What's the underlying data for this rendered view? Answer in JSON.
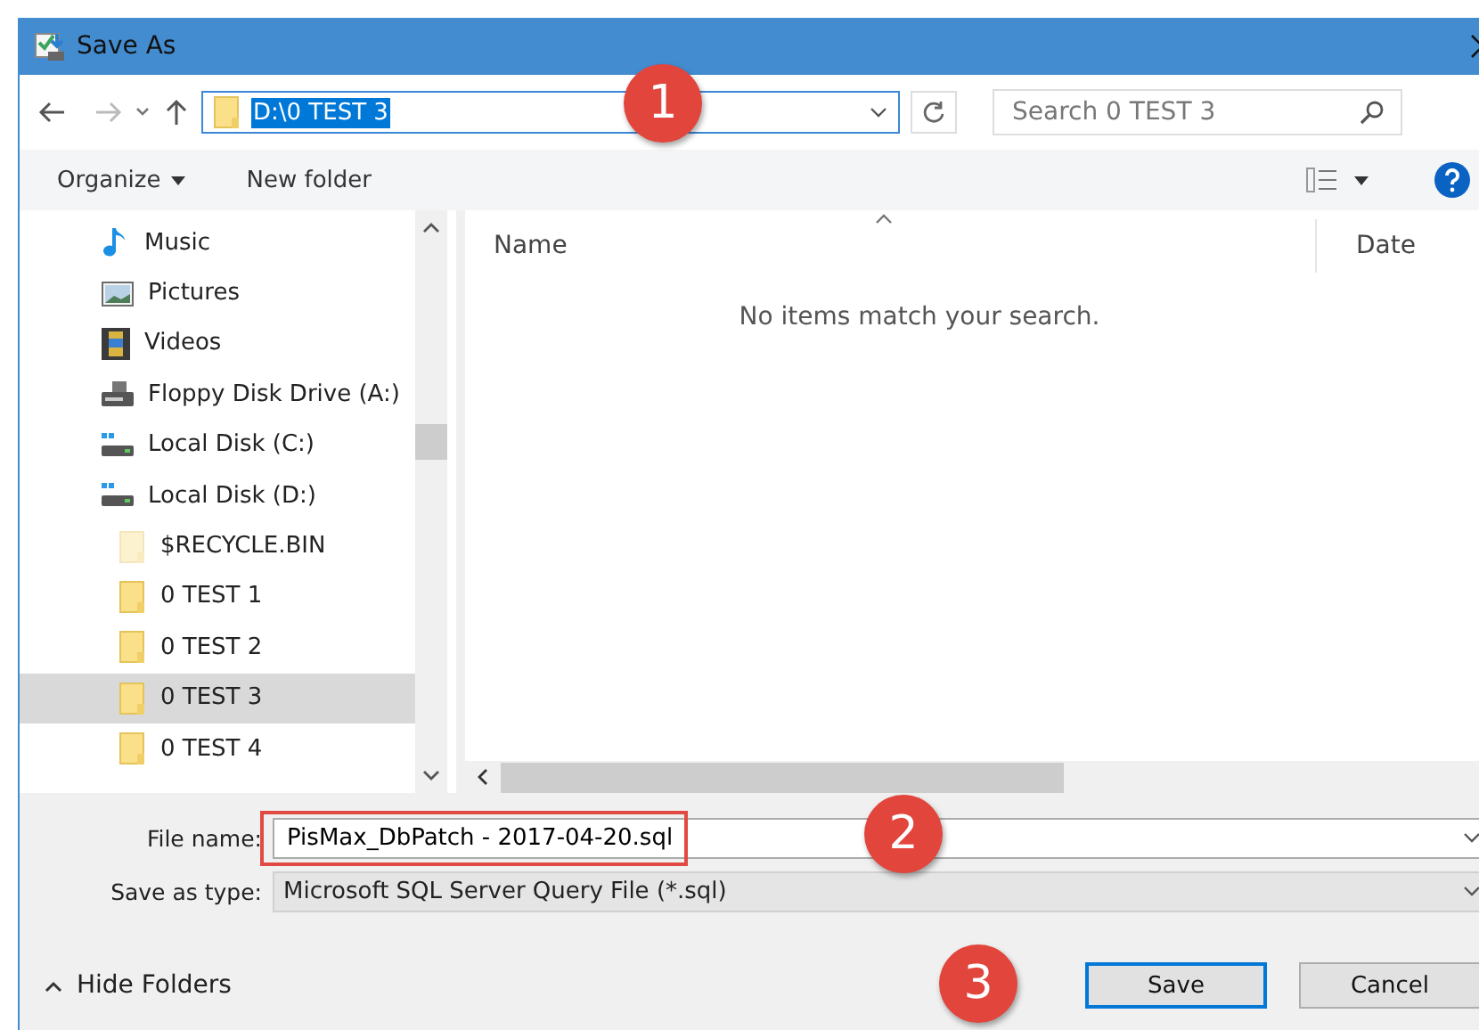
{
  "window": {
    "title": "Save As"
  },
  "address": {
    "path": "D:\\0 TEST 3",
    "selected": true
  },
  "search": {
    "placeholder": "Search 0 TEST 3"
  },
  "toolbar": {
    "organize": "Organize",
    "new_folder": "New folder"
  },
  "nav": [
    {
      "label": "Music",
      "kind": "music",
      "selected": false
    },
    {
      "label": "Pictures",
      "kind": "pictures",
      "selected": false
    },
    {
      "label": "Videos",
      "kind": "videos",
      "selected": false
    },
    {
      "label": "Floppy Disk Drive (A:)",
      "kind": "floppy",
      "selected": false
    },
    {
      "label": "Local Disk (C:)",
      "kind": "disk",
      "selected": false
    },
    {
      "label": "Local Disk (D:)",
      "kind": "disk",
      "selected": false,
      "children": [
        {
          "label": "$RECYCLE.BIN",
          "kind": "folder",
          "hidden": true,
          "selected": false
        },
        {
          "label": "0 TEST 1",
          "kind": "folder",
          "hidden": false,
          "selected": false
        },
        {
          "label": "0 TEST 2",
          "kind": "folder",
          "hidden": false,
          "selected": false
        },
        {
          "label": "0 TEST 3",
          "kind": "folder",
          "hidden": false,
          "selected": true
        },
        {
          "label": "0 TEST 4",
          "kind": "folder",
          "hidden": false,
          "selected": false
        }
      ]
    }
  ],
  "columns": [
    "Name",
    "Date"
  ],
  "empty_message": "No items match your search.",
  "file_name": {
    "label": "File name:",
    "value": "PisMax_DbPatch - 2017-04-20.sql",
    "highlighted": true
  },
  "save_type": {
    "label": "Save as type:",
    "value": "Microsoft SQL Server Query File (*.sql)"
  },
  "hide_folders": "Hide Folders",
  "buttons": [
    {
      "label": "Save",
      "default": true
    },
    {
      "label": "Cancel",
      "default": false
    }
  ],
  "callouts": [
    "1",
    "2",
    "3"
  ]
}
